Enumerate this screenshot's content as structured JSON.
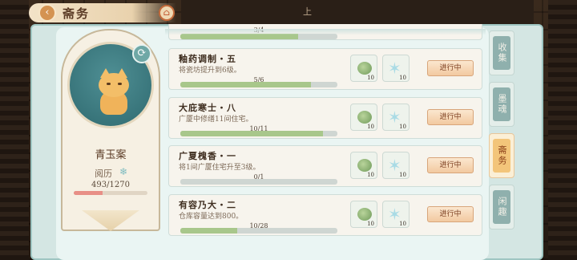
{
  "header": {
    "back_icon": "back-arrow-icon",
    "title": "斋务",
    "home_icon": "home-icon",
    "top_dark_text": "上"
  },
  "profile": {
    "name": "青玉案",
    "rank_label": "阅历",
    "progress_text": "493/1270",
    "progress_fraction": 0.388
  },
  "top_row": {
    "progress_text": "3/4",
    "progress_fraction": 0.75
  },
  "tasks": [
    {
      "title": "釉药调制・五",
      "desc": "将瓷坊提升到6级。",
      "progress_text": "5/6",
      "progress_fraction": 0.83,
      "reward1_qty": "10",
      "reward2_qty": "10",
      "status": "进行中"
    },
    {
      "title": "大庇寒士・八",
      "desc": "广厦中修缮11间住宅。",
      "progress_text": "10/11",
      "progress_fraction": 0.91,
      "reward1_qty": "10",
      "reward2_qty": "10",
      "status": "进行中"
    },
    {
      "title": "广夏槐香・一",
      "desc": "将1间广厦住宅升至3级。",
      "progress_text": "0/1",
      "progress_fraction": 0.0,
      "reward1_qty": "10",
      "reward2_qty": "10",
      "status": "进行中"
    },
    {
      "title": "有容乃大・二",
      "desc": "仓库容量达到800。",
      "progress_text": "10/28",
      "progress_fraction": 0.36,
      "reward1_qty": "10",
      "reward2_qty": "10",
      "status": "进行中"
    }
  ],
  "tabs": [
    "收集",
    "墨魂",
    "斋务",
    "闲趣"
  ],
  "colors": {
    "accent": "#f3c57a",
    "panel": "#d4e6e3",
    "bar_fill": "#a8c78b"
  }
}
